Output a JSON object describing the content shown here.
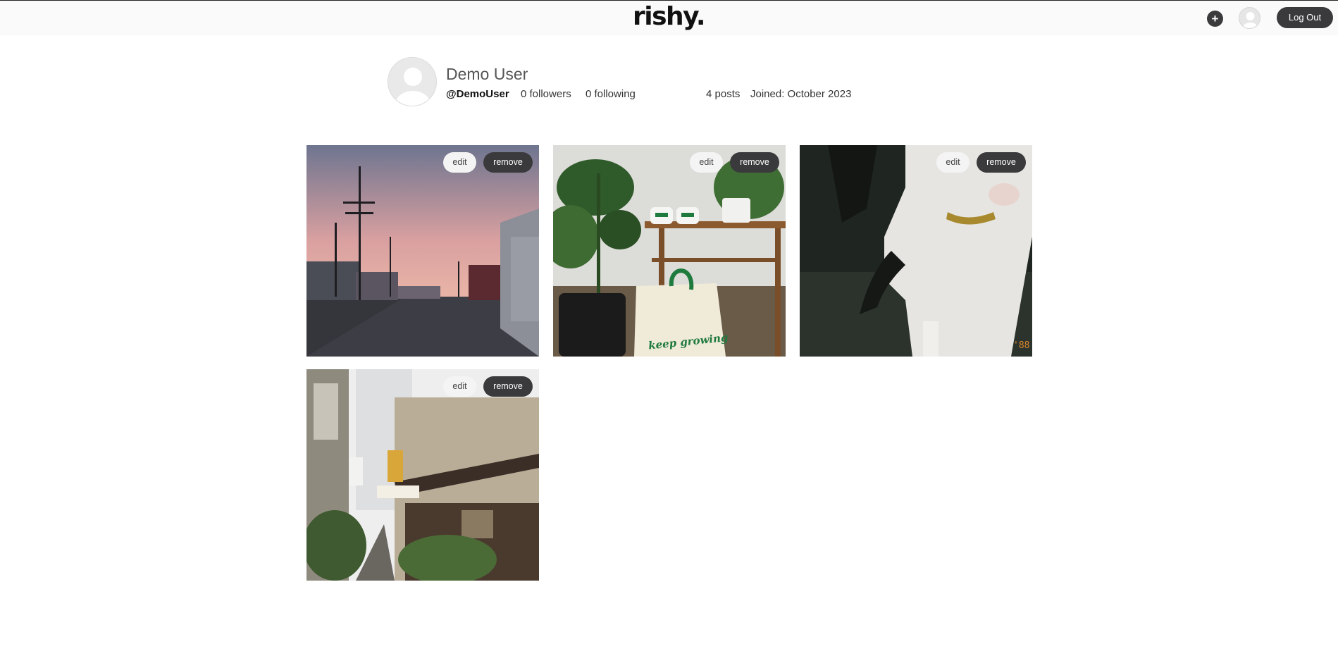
{
  "header": {
    "logo": "rishy.",
    "add_label": "+",
    "logout_label": "Log Out"
  },
  "profile": {
    "name": "Demo User",
    "handle": "@DemoUser",
    "followers": "0 followers",
    "following": "0 following",
    "posts": "4 posts",
    "joined": "Joined: October 2023"
  },
  "posts": [
    {
      "edit_label": "edit",
      "remove_label": "remove"
    },
    {
      "edit_label": "edit",
      "remove_label": "remove",
      "bag_text": "keep growing"
    },
    {
      "edit_label": "edit",
      "remove_label": "remove",
      "stamp": "'88"
    },
    {
      "edit_label": "edit",
      "remove_label": "remove"
    }
  ]
}
